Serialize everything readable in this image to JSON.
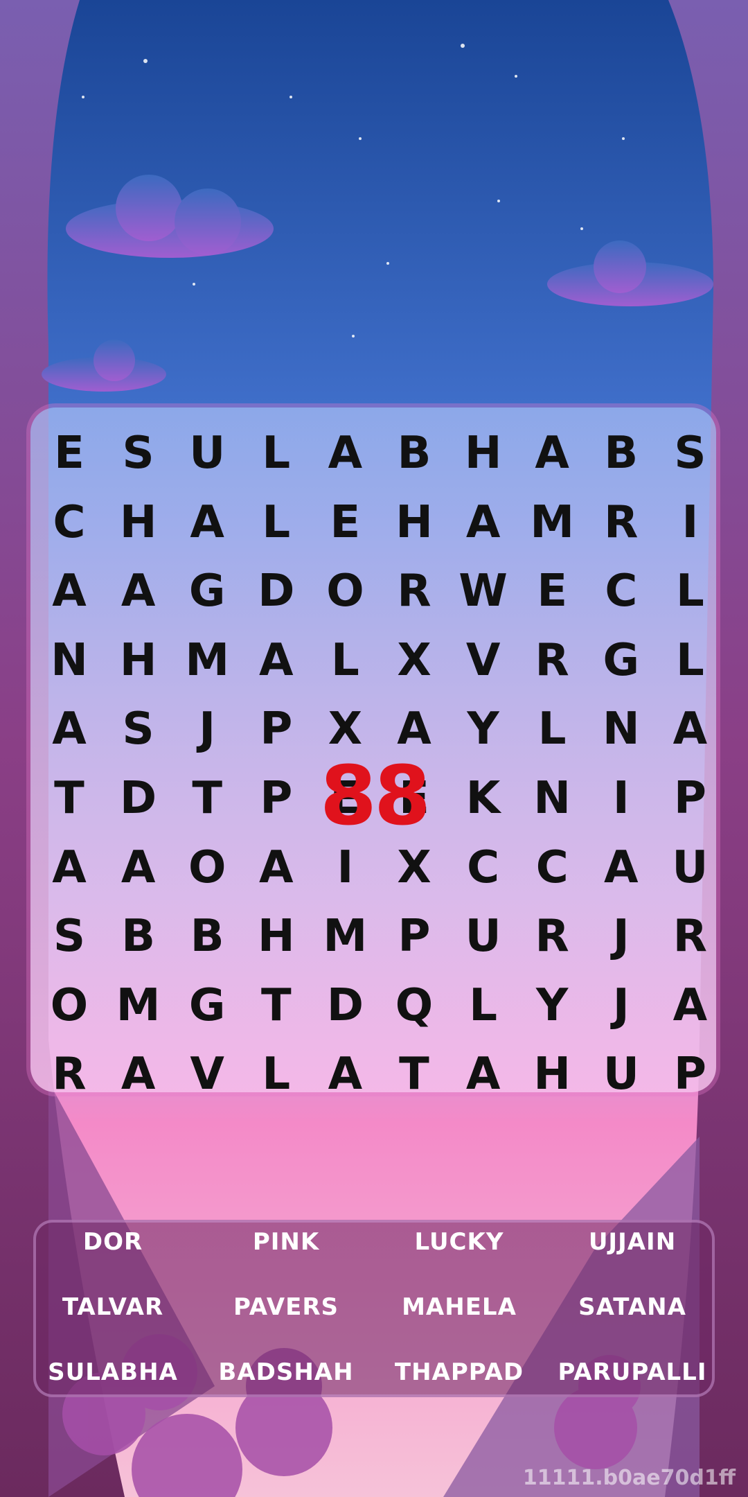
{
  "colors": {
    "sky_top": "#1a4596",
    "sky_bottom": "#8fa8ee",
    "frame": "#8a3f86",
    "timer": "#e0121c",
    "letter": "#111111"
  },
  "grid": {
    "rows": [
      [
        "E",
        "S",
        "U",
        "L",
        "A",
        "B",
        "H",
        "A",
        "B",
        "S"
      ],
      [
        "C",
        "H",
        "A",
        "L",
        "E",
        "H",
        "A",
        "M",
        "R",
        "I"
      ],
      [
        "A",
        "A",
        "G",
        "D",
        "O",
        "R",
        "W",
        "E",
        "C",
        "L"
      ],
      [
        "N",
        "H",
        "M",
        "A",
        "L",
        "X",
        "V",
        "R",
        "G",
        "L"
      ],
      [
        "A",
        "S",
        "J",
        "P",
        "X",
        "A",
        "Y",
        "L",
        "N",
        "A"
      ],
      [
        "T",
        "D",
        "T",
        "P",
        "E",
        "E",
        "K",
        "N",
        "I",
        "P"
      ],
      [
        "A",
        "A",
        "O",
        "A",
        "I",
        "X",
        "C",
        "C",
        "A",
        "U"
      ],
      [
        "S",
        "B",
        "B",
        "H",
        "M",
        "P",
        "U",
        "R",
        "J",
        "R"
      ],
      [
        "O",
        "M",
        "G",
        "T",
        "D",
        "Q",
        "L",
        "Y",
        "J",
        "A"
      ],
      [
        "R",
        "A",
        "V",
        "L",
        "A",
        "T",
        "A",
        "H",
        "U",
        "P"
      ]
    ]
  },
  "timer": {
    "value": "88"
  },
  "words": [
    "DOR",
    "PINK",
    "LUCKY",
    "UJJAIN",
    "TALVAR",
    "PAVERS",
    "MAHELA",
    "SATANA",
    "SULABHA",
    "BADSHAH",
    "THAPPAD",
    "PARUPALLI"
  ],
  "footer": {
    "build_id": "11111.b0ae70d1ff"
  }
}
